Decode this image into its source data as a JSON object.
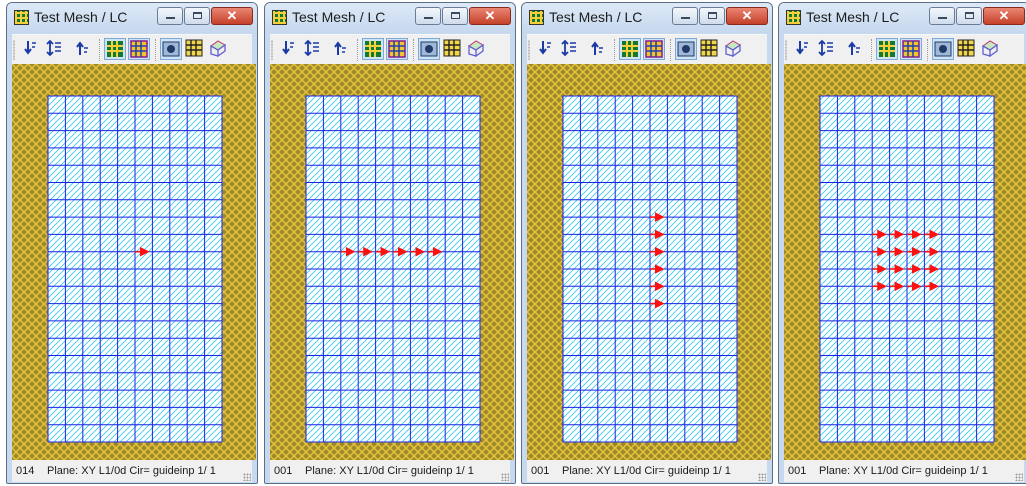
{
  "colors": {
    "grid": "#1a22e6",
    "hatch": "#35c8f0",
    "border_fill": "#9a8a2a",
    "border_hatch": "#e7c23a",
    "arrow": "#ff1010"
  },
  "toolbar_icons": [
    "sort-down-icon",
    "sort-both-icon",
    "sort-up-icon",
    "mesh-icon",
    "mesh-highlight-icon",
    "camera-view-icon",
    "grid-icon",
    "3d-box-icon"
  ],
  "mesh": {
    "columns": 10,
    "rows": 20
  },
  "windows": [
    {
      "title": "Test Mesh / LC",
      "status_id": "014",
      "status_text": "Plane: XY  L1/0d  Cir= guideinp  1/ 1",
      "arrows": [
        {
          "col": 5,
          "row": 9
        }
      ]
    },
    {
      "title": "Test Mesh / LC",
      "status_id": "001",
      "status_text": "Plane: XY  L1/0d  Cir= guideinp  1/ 1",
      "arrows": [
        {
          "col": 2,
          "row": 9
        },
        {
          "col": 3,
          "row": 9
        },
        {
          "col": 4,
          "row": 9
        },
        {
          "col": 5,
          "row": 9
        },
        {
          "col": 6,
          "row": 9
        },
        {
          "col": 7,
          "row": 9
        }
      ]
    },
    {
      "title": "Test Mesh / LC",
      "status_id": "001",
      "status_text": "Plane: XY  L1/0d  Cir= guideinp  1/ 1",
      "arrows": [
        {
          "col": 5,
          "row": 7
        },
        {
          "col": 5,
          "row": 8
        },
        {
          "col": 5,
          "row": 9
        },
        {
          "col": 5,
          "row": 10
        },
        {
          "col": 5,
          "row": 11
        },
        {
          "col": 5,
          "row": 12
        }
      ]
    },
    {
      "title": "Test Mesh / LC",
      "status_id": "001",
      "status_text": "Plane: XY  L1/0d  Cir= guideinp  1/ 1",
      "arrows": [
        {
          "col": 3,
          "row": 8
        },
        {
          "col": 4,
          "row": 8
        },
        {
          "col": 5,
          "row": 8
        },
        {
          "col": 6,
          "row": 8
        },
        {
          "col": 3,
          "row": 9
        },
        {
          "col": 4,
          "row": 9
        },
        {
          "col": 5,
          "row": 9
        },
        {
          "col": 6,
          "row": 9
        },
        {
          "col": 3,
          "row": 10
        },
        {
          "col": 4,
          "row": 10
        },
        {
          "col": 5,
          "row": 10
        },
        {
          "col": 6,
          "row": 10
        },
        {
          "col": 3,
          "row": 11
        },
        {
          "col": 4,
          "row": 11
        },
        {
          "col": 5,
          "row": 11
        },
        {
          "col": 6,
          "row": 11
        }
      ]
    }
  ]
}
